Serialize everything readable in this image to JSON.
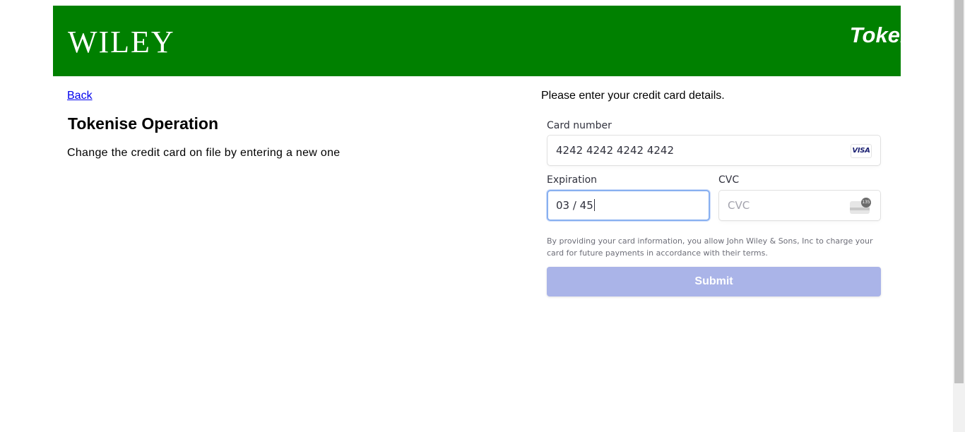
{
  "header": {
    "logo": "WILEY",
    "title": "Tokenise",
    "background": "#008000"
  },
  "left": {
    "back_link": "Back",
    "title": "Tokenise Operation",
    "description": "Change the credit card on file by entering a new one"
  },
  "form": {
    "intro": "Please enter your credit card details.",
    "card_number_label": "Card number",
    "card_number_value": "4242 4242 4242 4242",
    "card_brand": "VISA",
    "expiration_label": "Expiration",
    "expiration_value": "03 / 45",
    "cvc_label": "CVC",
    "cvc_placeholder": "CVC",
    "cvc_icon_digits": "135",
    "terms": "By providing your card information, you allow John Wiley & Sons, Inc to charge your card for future payments in accordance with their terms.",
    "submit_label": "Submit",
    "submit_color": "#aab4e8"
  },
  "icons": {
    "card_brand_icon": "visa-card-icon",
    "cvc_icon": "card-cvc-icon"
  }
}
